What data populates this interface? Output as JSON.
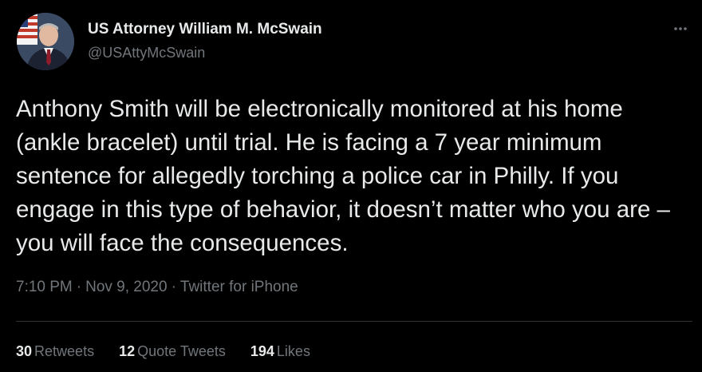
{
  "author": {
    "display_name": "US Attorney William M. McSwain",
    "handle": "@USAttyMcSwain",
    "avatar_icon": "profile-photo"
  },
  "tweet": {
    "text": "Anthony Smith will be electronically monitored at his home (ankle bracelet) until trial. He is facing a 7 year minimum sentence for allegedly torching a police car in Philly. If you engage in this type of behavior, it doesn’t matter who you are – you will face the consequences.",
    "time": "7:10 PM",
    "date": "Nov 9, 2020",
    "source": "Twitter for iPhone",
    "separator": "·"
  },
  "stats": {
    "retweets_count": "30",
    "retweets_label": "Retweets",
    "quote_tweets_count": "12",
    "quote_tweets_label": "Quote Tweets",
    "likes_count": "194",
    "likes_label": "Likes"
  },
  "menu": {
    "icon": "more-horizontal-icon"
  },
  "colors": {
    "background": "#000000",
    "text_primary": "#e7e9ea",
    "text_secondary": "#71767b",
    "divider": "#2f3336"
  }
}
